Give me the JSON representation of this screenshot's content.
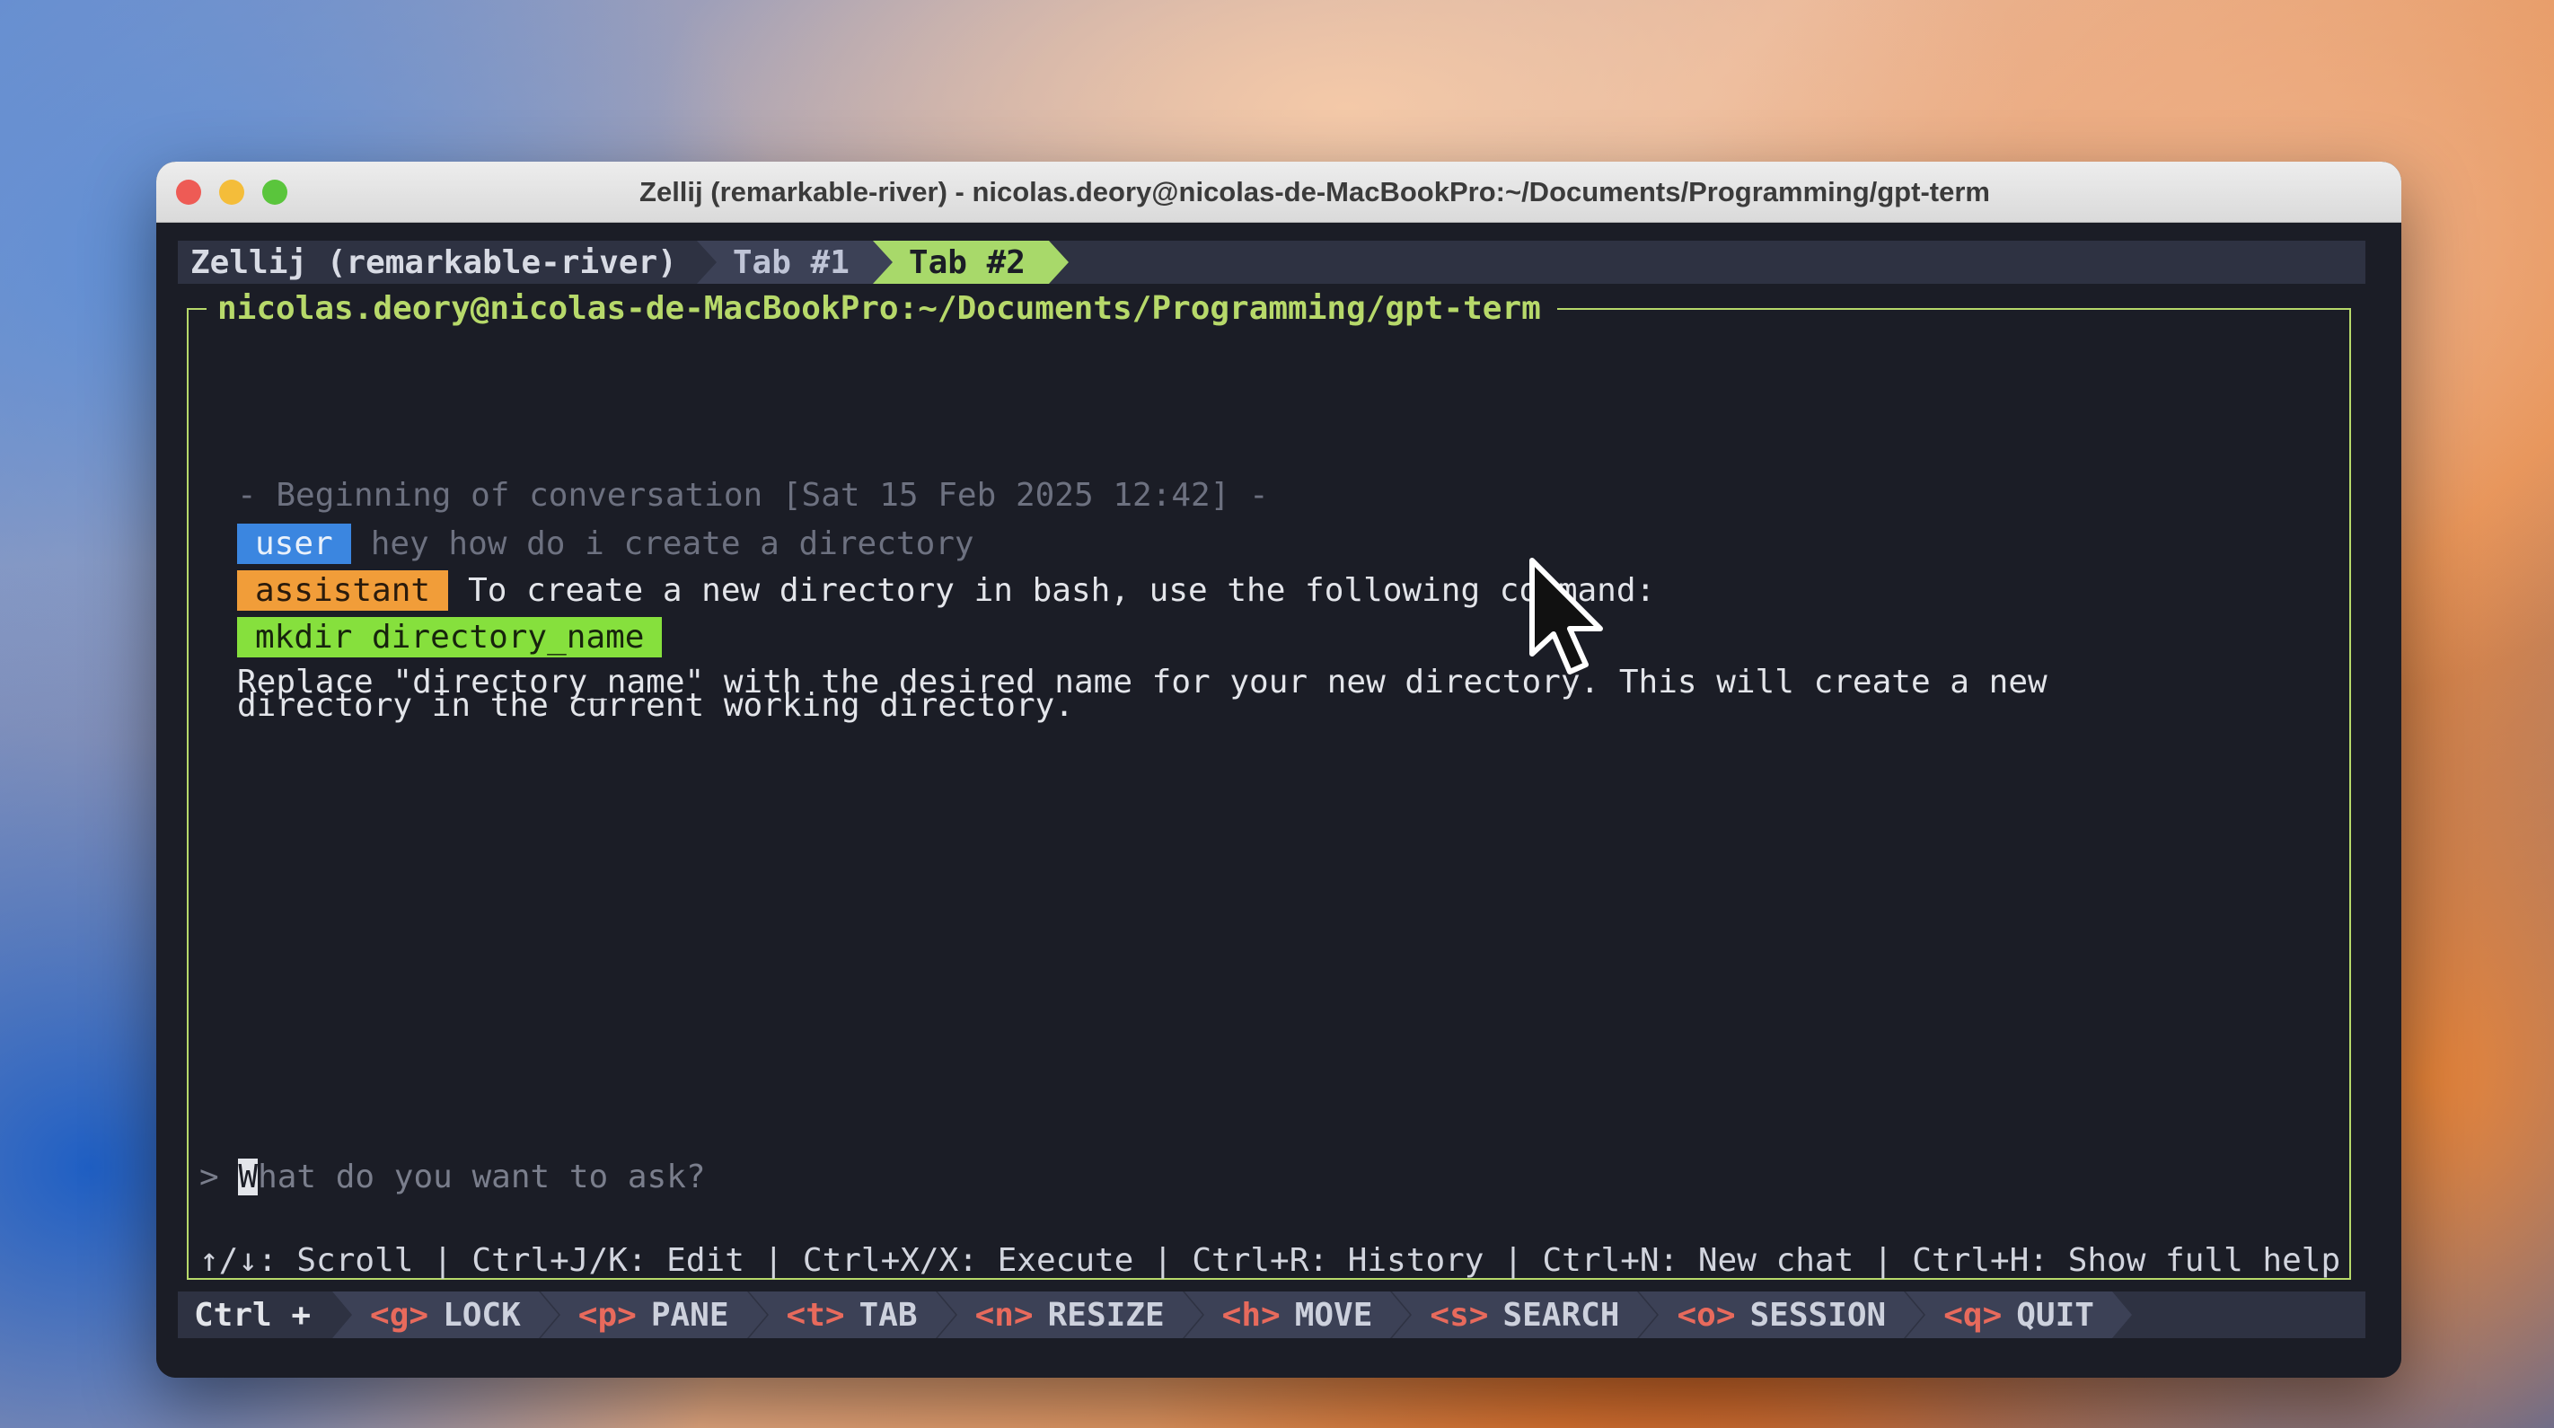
{
  "window": {
    "title": "Zellij (remarkable-river) - nicolas.deory@nicolas-de-MacBookPro:~/Documents/Programming/gpt-term"
  },
  "tabbar": {
    "session": "Zellij (remarkable-river)",
    "tabs": [
      {
        "label": "Tab #1",
        "active": false
      },
      {
        "label": "Tab #2",
        "active": true
      }
    ]
  },
  "pane": {
    "title": "nicolas.deory@nicolas-de-MacBookPro:~/Documents/Programming/gpt-term"
  },
  "conversation": {
    "header": "- Beginning of conversation [Sat 15 Feb 2025 12:42] -",
    "messages": [
      {
        "role": "user",
        "text": "hey how do i create a directory"
      },
      {
        "role": "assistant",
        "text": "To create a new directory in bash, use the following command:"
      }
    ],
    "code": "mkdir directory_name",
    "explanation_line1": "Replace \"directory_name\" with the desired name for your new directory. This will create a new",
    "explanation_line2": "directory in the current working directory."
  },
  "input": {
    "prompt_symbol": ">",
    "placeholder_first": "W",
    "placeholder_rest": "hat do you want to ask?"
  },
  "help": {
    "text": "↑/↓: Scroll | Ctrl+J/K: Edit | Ctrl+X/X: Execute | Ctrl+R: History | Ctrl+N: New chat | Ctrl+H: Show full help"
  },
  "statusbar": {
    "prefix": "Ctrl +",
    "items": [
      {
        "key": "<g>",
        "label": "LOCK"
      },
      {
        "key": "<p>",
        "label": "PANE"
      },
      {
        "key": "<t>",
        "label": "TAB"
      },
      {
        "key": "<n>",
        "label": "RESIZE"
      },
      {
        "key": "<h>",
        "label": "MOVE"
      },
      {
        "key": "<s>",
        "label": "SEARCH"
      },
      {
        "key": "<o>",
        "label": "SESSION"
      },
      {
        "key": "<q>",
        "label": "QUIT"
      }
    ]
  },
  "colors": {
    "accent_green": "#b7d96a",
    "user_badge": "#3b86e0",
    "assistant_badge": "#f19d39",
    "code_bg": "#86e03d",
    "key_red": "#e86a5c"
  }
}
